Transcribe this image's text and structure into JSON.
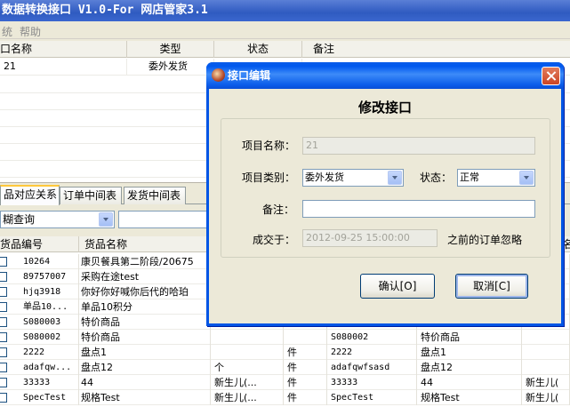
{
  "app": {
    "title": "数据转换接口 V1.0-For 网店管家3.1",
    "menu": [
      "统",
      "帮助"
    ]
  },
  "top_grid": {
    "headers": [
      "口名称",
      "类型",
      "状态",
      "备注"
    ],
    "rows": [
      [
        "21",
        "委外发货",
        "",
        ""
      ]
    ]
  },
  "tabs": [
    "品对应关系",
    "订单中间表",
    "发货中间表"
  ],
  "filter": {
    "mode": "糊查询",
    "text": ""
  },
  "bottom_grid": {
    "headers": [
      "货品编号",
      "货品名称",
      "",
      "",
      "",
      "",
      "名"
    ],
    "rows": [
      [
        "10264",
        "康贝餐具第二阶段/20675",
        "",
        "",
        "",
        "",
        ""
      ],
      [
        "89757007",
        "采购在途test",
        "",
        "",
        "",
        "",
        ""
      ],
      [
        "hjq3918",
        "你好你好喊你后代的哈珀",
        "",
        "",
        "",
        "",
        ""
      ],
      [
        "单品10...",
        "单品10积分",
        "",
        "",
        "",
        "",
        ""
      ],
      [
        "S080003",
        "特价商品",
        "",
        "",
        "",
        "",
        ""
      ],
      [
        "S080002",
        "特价商品",
        "",
        "",
        "S080002",
        "特价商品",
        ""
      ],
      [
        "2222",
        "盘点1",
        "",
        "件",
        "2222",
        "盘点1",
        ""
      ],
      [
        "adafqw...",
        "盘点12",
        "个",
        "件",
        "adafqwfsasd",
        "盘点12",
        ""
      ],
      [
        "33333",
        "44",
        "新生儿(...",
        "件",
        "33333",
        "44",
        "新生儿("
      ],
      [
        "SpecTest",
        "规格Test",
        "新生儿(...",
        "件",
        "SpecTest",
        "规格Test",
        "新生儿("
      ]
    ]
  },
  "dialog": {
    "title": "接口编辑",
    "heading": "修改接口",
    "name_label": "项目名称：",
    "name_value": "21",
    "type_label": "项目类别：",
    "type_value": "委外发货",
    "status_label": "状态：",
    "status_value": "正常",
    "remark_label": "备注：",
    "remark_value": "",
    "deal_label": "成交于：",
    "deal_value": "2012-09-25 15:00:00",
    "deal_suffix": "之前的订单忽略",
    "ok_label": "确认[O]",
    "cancel_label": "取消[C]"
  }
}
